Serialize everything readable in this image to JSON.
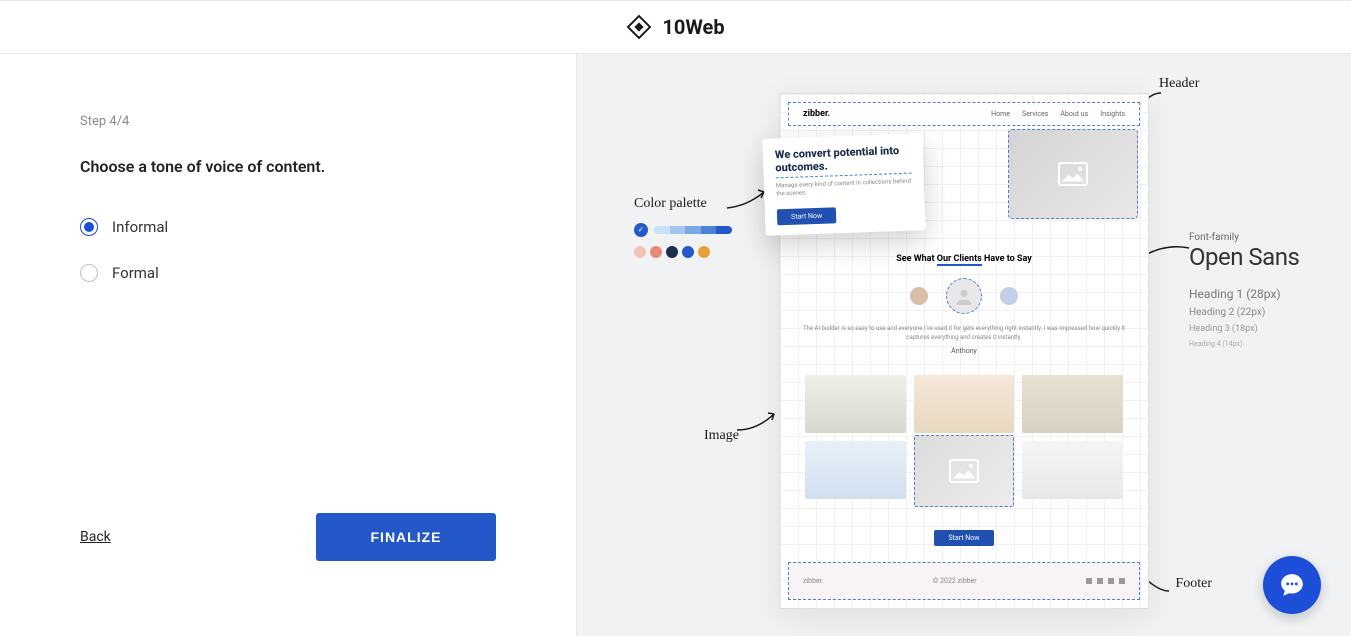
{
  "brand": {
    "name": "10Web"
  },
  "step": {
    "label": "Step 4/4",
    "question": "Choose a tone of voice of content."
  },
  "options": [
    {
      "label": "Informal",
      "selected": true
    },
    {
      "label": "Formal",
      "selected": false
    }
  ],
  "actions": {
    "back": "Back",
    "finalize": "FINALIZE"
  },
  "preview": {
    "brand": "zibber.",
    "nav": [
      "Home",
      "Services",
      "About us",
      "Insights"
    ],
    "hero": {
      "title": "We convert potential into outcomes.",
      "desc": "Manage every kind of content in collections behind the scenes.",
      "cta": "Start Now"
    },
    "testimonials": {
      "heading_pre": "See What ",
      "heading_under": "Our Clients",
      "heading_post": " Have to Say",
      "text": "The AI builder is so easy to use and everyone I've used it for gets everything right instantly. I was impressed how quickly it captures everything and creates it instantly.",
      "name": "Anthony"
    },
    "cta": "Start Now",
    "footer": {
      "brand": "zibber.",
      "copyright": "© 2022 zibber"
    }
  },
  "annotations": {
    "header": "Header",
    "color_palette": "Color palette",
    "image": "Image",
    "footer": "Footer",
    "font_family_label": "Font-family",
    "font_family": "Open Sans",
    "h1": "Heading 1 (28px)",
    "h2": "Heading 2 (22px)",
    "h3": "Heading 3 (18px)",
    "h4": "Heading 4 (14px)"
  },
  "colors": {
    "palette_bar": [
      "#cbe0f7",
      "#a7c6ee",
      "#7ba8e3",
      "#4a82d6",
      "#2458c9"
    ],
    "palette_dots": [
      "#f2c3b3",
      "#e88a76",
      "#1d2e4a",
      "#2458c9",
      "#e8a23c"
    ]
  }
}
